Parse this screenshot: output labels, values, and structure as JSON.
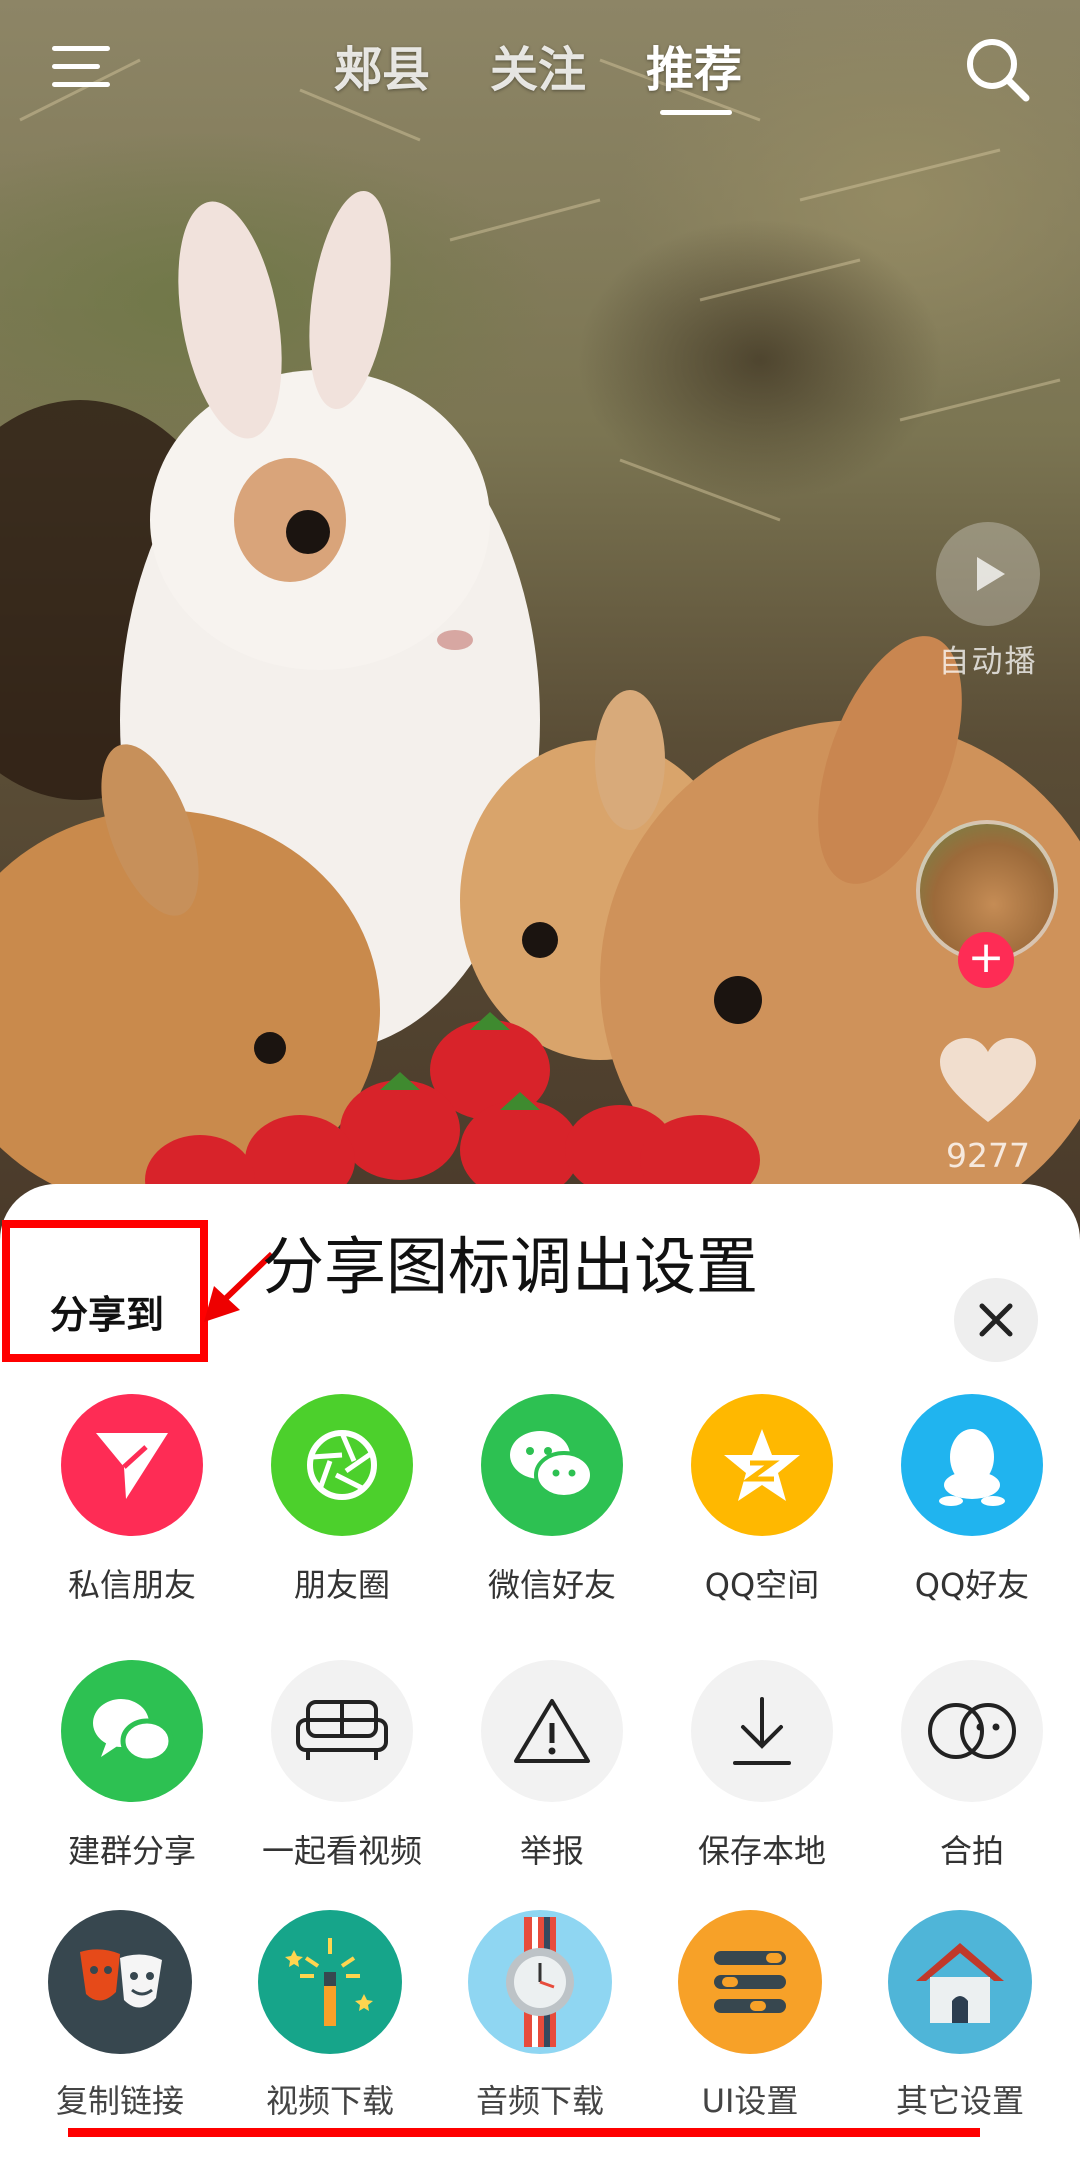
{
  "top_tabs": [
    "郏县",
    "关注",
    "推荐"
  ],
  "active_tab": "推荐",
  "right_rail": {
    "autoplay_label": "自动播",
    "like_count": "9277"
  },
  "sheet": {
    "title": "分享到",
    "annotation": "分享图标调出设置"
  },
  "share_row1": [
    {
      "label": "私信朋友",
      "icon": "paper-plane-icon",
      "color": "#fe2c55"
    },
    {
      "label": "朋友圈",
      "icon": "aperture-icon",
      "color": "#4cd02c"
    },
    {
      "label": "微信好友",
      "icon": "wechat-icon",
      "color": "#2dc152"
    },
    {
      "label": "QQ空间",
      "icon": "qzone-star-icon",
      "color": "#ffb800"
    },
    {
      "label": "QQ好友",
      "icon": "qq-penguin-icon",
      "color": "#20b4ef"
    }
  ],
  "share_row2": [
    {
      "label": "建群分享",
      "icon": "group-chat-icon",
      "color": "#2dc152"
    },
    {
      "label": "一起看视频",
      "icon": "sofa-icon",
      "color": "#f2f2f2"
    },
    {
      "label": "举报",
      "icon": "warning-icon",
      "color": "#f2f2f2"
    },
    {
      "label": "保存本地",
      "icon": "download-icon",
      "color": "#f2f2f2"
    },
    {
      "label": "合拍",
      "icon": "duet-icon",
      "color": "#f2f2f2"
    }
  ],
  "share_row3": [
    {
      "label": "复制链接",
      "icon": "theater-masks-icon",
      "color": "#37474f"
    },
    {
      "label": "视频下载",
      "icon": "magic-wand-icon",
      "color": "#16a58a"
    },
    {
      "label": "音频下载",
      "icon": "wristwatch-icon",
      "color": "#8fd6f2"
    },
    {
      "label": "UI设置",
      "icon": "settings-list-icon",
      "color": "#f7a128"
    },
    {
      "label": "其它设置",
      "icon": "home-icon",
      "color": "#4fb5d8"
    }
  ]
}
